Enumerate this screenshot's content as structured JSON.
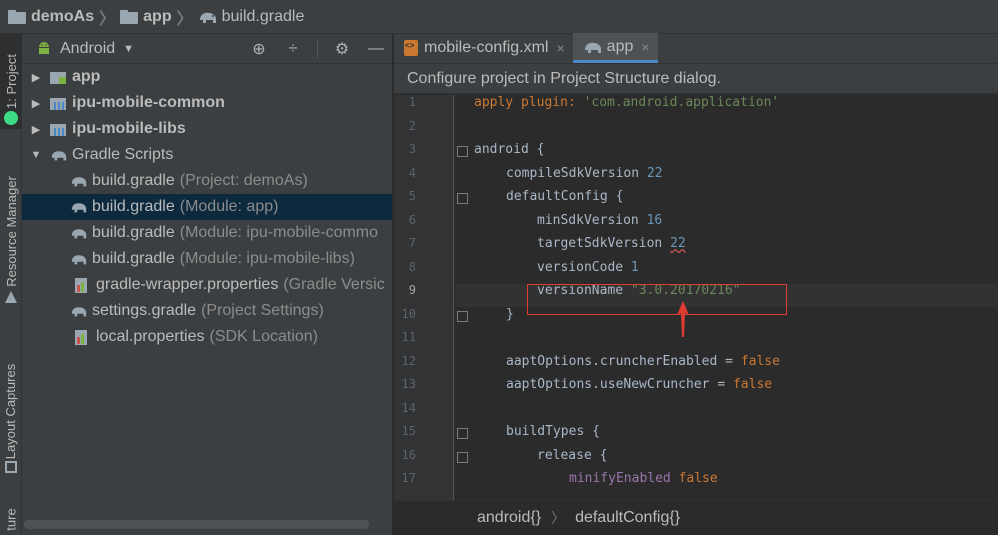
{
  "breadcrumb": {
    "items": [
      {
        "label": "demoAs",
        "icon": "folder-icon"
      },
      {
        "label": "app",
        "icon": "folder-icon"
      },
      {
        "label": "build.gradle",
        "icon": "gradle-icon"
      }
    ]
  },
  "left_strip": {
    "tabs": [
      "1: Project",
      "Resource Manager",
      "Layout Captures",
      "ture"
    ]
  },
  "project_panel": {
    "view_label": "Android",
    "tools": [
      "target-icon",
      "collapse-icon",
      "gear-icon",
      "minimize-icon"
    ],
    "tree": [
      {
        "label": "app",
        "sub": "",
        "bold": true
      },
      {
        "label": "ipu-mobile-common",
        "sub": "",
        "bold": true
      },
      {
        "label": "ipu-mobile-libs",
        "sub": "",
        "bold": true
      },
      {
        "label": "Gradle Scripts",
        "sub": "",
        "bold": false
      },
      {
        "label": "build.gradle",
        "sub": "(Project: demoAs)"
      },
      {
        "label": "build.gradle",
        "sub": "(Module: app)"
      },
      {
        "label": "build.gradle",
        "sub": "(Module: ipu-mobile-commo"
      },
      {
        "label": "build.gradle",
        "sub": "(Module: ipu-mobile-libs)"
      },
      {
        "label": "gradle-wrapper.properties",
        "sub": "(Gradle Versic"
      },
      {
        "label": "settings.gradle",
        "sub": "(Project Settings)"
      },
      {
        "label": "local.properties",
        "sub": "(SDK Location)"
      }
    ]
  },
  "editor": {
    "tabs": [
      {
        "label": "mobile-config.xml",
        "close": "×"
      },
      {
        "label": "app",
        "close": "×"
      }
    ],
    "notice": "Configure project in Project Structure dialog.",
    "line_numbers": [
      "1",
      "2",
      "3",
      "4",
      "5",
      "6",
      "7",
      "8",
      "9",
      "10",
      "11",
      "12",
      "13",
      "14",
      "15",
      "16",
      "17"
    ],
    "code": {
      "l1_kw": "apply plugin:",
      "l1_str": "'com.android.application'",
      "l3": "android {",
      "l4_key": "compileSdkVersion",
      "l4_val": "22",
      "l5": "defaultConfig {",
      "l6_key": "minSdkVersion",
      "l6_val": "16",
      "l7_key": "targetSdkVersion",
      "l7_val": "22",
      "l8_key": "versionCode",
      "l8_val": "1",
      "l9_key": "versionName",
      "l9_val": "\"3.0.20170216\"",
      "l10": "}",
      "l12_key": "aaptOptions.cruncherEnabled =",
      "l12_val": "false",
      "l13_key": "aaptOptions.useNewCruncher =",
      "l13_val": "false",
      "l15": "buildTypes {",
      "l16": "release {",
      "l17_key": "minifyEnabled",
      "l17_val": "false"
    },
    "status_crumbs": [
      "android{}",
      "defaultConfig{}"
    ]
  },
  "colors": {
    "accent": "#4a88c7",
    "annotation": "#e03c31",
    "selection": "#0d293e"
  }
}
